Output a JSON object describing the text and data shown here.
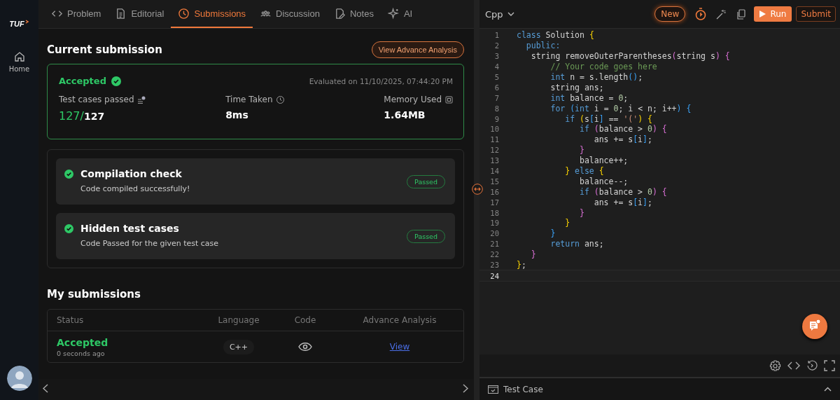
{
  "sidebar": {
    "logo": "TUF",
    "items": [
      {
        "label": "Home",
        "selected": false
      }
    ]
  },
  "tabs": [
    {
      "label": "Problem",
      "selected": false
    },
    {
      "label": "Editorial",
      "selected": false
    },
    {
      "label": "Submissions",
      "selected": true
    },
    {
      "label": "Discussion",
      "selected": false
    },
    {
      "label": "Notes",
      "selected": false
    },
    {
      "label": "AI",
      "selected": false
    }
  ],
  "current_submission": {
    "title": "Current submission",
    "action": "View Advance Analysis",
    "status": "Accepted",
    "evaluated": "Evaluated on 11/10/2025, 07:44:20 PM",
    "stats": [
      {
        "label": "Test cases passed",
        "passed": "127/",
        "total": "127"
      },
      {
        "label": "Time Taken",
        "total": "8ms"
      },
      {
        "label": "Memory Used",
        "total": "1.64MB"
      }
    ],
    "checks": [
      {
        "title": "Compilation check",
        "detail": "Code compiled successfully!",
        "badge": "Passed"
      },
      {
        "title": "Hidden test cases",
        "detail": "Code Passed for the given test case",
        "badge": "Passed"
      }
    ]
  },
  "my_submissions": {
    "title": "My submissions",
    "columns": [
      "Status",
      "Language",
      "Code",
      "Advance Analysis"
    ],
    "rows": [
      {
        "status": "Accepted",
        "time": "0 seconds ago",
        "language": "C++",
        "link": "View"
      }
    ]
  },
  "editor": {
    "language": "Cpp",
    "new_button": "New",
    "run": "Run",
    "submit": "Submit",
    "lines": [
      {
        "n": "1",
        "current": false,
        "tokens": [
          {
            "text": "class",
            "kind": "kw"
          },
          {
            "text": " Solution ",
            "kind": "txt"
          },
          {
            "text": "{",
            "kind": "b1"
          }
        ]
      },
      {
        "n": "2",
        "current": false,
        "tokens": [
          {
            "text": "  public:",
            "kind": "kw"
          }
        ]
      },
      {
        "n": "3",
        "current": false,
        "tokens": [
          {
            "text": "   string removeOuterParentheses",
            "kind": "txt"
          },
          {
            "text": "(",
            "kind": "b2"
          },
          {
            "text": "string s",
            "kind": "txt"
          },
          {
            "text": ") {",
            "kind": "b2"
          }
        ]
      },
      {
        "n": "4",
        "current": false,
        "tokens": [
          {
            "text": "       // Your code goes here",
            "kind": "com"
          }
        ]
      },
      {
        "n": "5",
        "current": false,
        "tokens": [
          {
            "text": "       int",
            "kind": "kw"
          },
          {
            "text": " n = s.length",
            "kind": "txt"
          },
          {
            "text": "()",
            "kind": "b3"
          },
          {
            "text": ";",
            "kind": "txt"
          }
        ]
      },
      {
        "n": "6",
        "current": false,
        "tokens": [
          {
            "text": "       string ans;",
            "kind": "txt"
          }
        ]
      },
      {
        "n": "7",
        "current": false,
        "tokens": [
          {
            "text": "       int",
            "kind": "kw"
          },
          {
            "text": " balance = ",
            "kind": "txt"
          },
          {
            "text": "0",
            "kind": "num"
          },
          {
            "text": ";",
            "kind": "txt"
          }
        ]
      },
      {
        "n": "8",
        "current": false,
        "tokens": [
          {
            "text": "       for",
            "kind": "kw"
          },
          {
            "text": " (",
            "kind": "b3"
          },
          {
            "text": "int",
            "kind": "kw"
          },
          {
            "text": " i = ",
            "kind": "txt"
          },
          {
            "text": "0",
            "kind": "num"
          },
          {
            "text": "; i < n; i++",
            "kind": "txt"
          },
          {
            "text": ") {",
            "kind": "b3"
          }
        ]
      },
      {
        "n": "9",
        "current": false,
        "tokens": [
          {
            "text": "          if",
            "kind": "kw"
          },
          {
            "text": " (",
            "kind": "b1"
          },
          {
            "text": "s",
            "kind": "txt"
          },
          {
            "text": "[",
            "kind": "b3"
          },
          {
            "text": "i",
            "kind": "txt"
          },
          {
            "text": "]",
            "kind": "b3"
          },
          {
            "text": " == ",
            "kind": "txt"
          },
          {
            "text": "'('",
            "kind": "str"
          },
          {
            "text": ") {",
            "kind": "b1"
          }
        ]
      },
      {
        "n": "10",
        "current": false,
        "tokens": [
          {
            "text": "             if",
            "kind": "kw"
          },
          {
            "text": " (",
            "kind": "b2"
          },
          {
            "text": "balance > ",
            "kind": "txt"
          },
          {
            "text": "0",
            "kind": "num"
          },
          {
            "text": ") {",
            "kind": "b2"
          }
        ]
      },
      {
        "n": "11",
        "current": false,
        "tokens": [
          {
            "text": "                ans += s",
            "kind": "txt"
          },
          {
            "text": "[",
            "kind": "b3"
          },
          {
            "text": "i",
            "kind": "txt"
          },
          {
            "text": "]",
            "kind": "b3"
          },
          {
            "text": ";",
            "kind": "txt"
          }
        ]
      },
      {
        "n": "12",
        "current": false,
        "tokens": [
          {
            "text": "             }",
            "kind": "b2"
          }
        ]
      },
      {
        "n": "13",
        "current": false,
        "tokens": [
          {
            "text": "             balance++;",
            "kind": "txt"
          }
        ]
      },
      {
        "n": "14",
        "current": false,
        "tokens": [
          {
            "text": "          }",
            "kind": "b1"
          },
          {
            "text": " else ",
            "kind": "kw"
          },
          {
            "text": "{",
            "kind": "b1"
          }
        ]
      },
      {
        "n": "15",
        "current": false,
        "tokens": [
          {
            "text": "             balance--;",
            "kind": "txt"
          }
        ]
      },
      {
        "n": "16",
        "current": false,
        "tokens": [
          {
            "text": "             if",
            "kind": "kw"
          },
          {
            "text": " (",
            "kind": "b2"
          },
          {
            "text": "balance > ",
            "kind": "txt"
          },
          {
            "text": "0",
            "kind": "num"
          },
          {
            "text": ") {",
            "kind": "b2"
          }
        ]
      },
      {
        "n": "17",
        "current": false,
        "tokens": [
          {
            "text": "                ans += s",
            "kind": "txt"
          },
          {
            "text": "[",
            "kind": "b3"
          },
          {
            "text": "i",
            "kind": "txt"
          },
          {
            "text": "]",
            "kind": "b3"
          },
          {
            "text": ";",
            "kind": "txt"
          }
        ]
      },
      {
        "n": "18",
        "current": false,
        "tokens": [
          {
            "text": "             }",
            "kind": "b2"
          }
        ]
      },
      {
        "n": "19",
        "current": false,
        "tokens": [
          {
            "text": "          }",
            "kind": "b1"
          }
        ]
      },
      {
        "n": "20",
        "current": false,
        "tokens": [
          {
            "text": "       }",
            "kind": "b3"
          }
        ]
      },
      {
        "n": "21",
        "current": false,
        "tokens": [
          {
            "text": "       return",
            "kind": "kw"
          },
          {
            "text": " ans;",
            "kind": "txt"
          }
        ]
      },
      {
        "n": "22",
        "current": false,
        "tokens": [
          {
            "text": "   }",
            "kind": "b2"
          }
        ]
      },
      {
        "n": "23",
        "current": false,
        "tokens": [
          {
            "text": "}",
            "kind": "b1"
          },
          {
            "text": ";",
            "kind": "txt"
          }
        ]
      },
      {
        "n": "24",
        "current": true
      }
    ]
  },
  "test_case": {
    "label": "Test Case"
  }
}
